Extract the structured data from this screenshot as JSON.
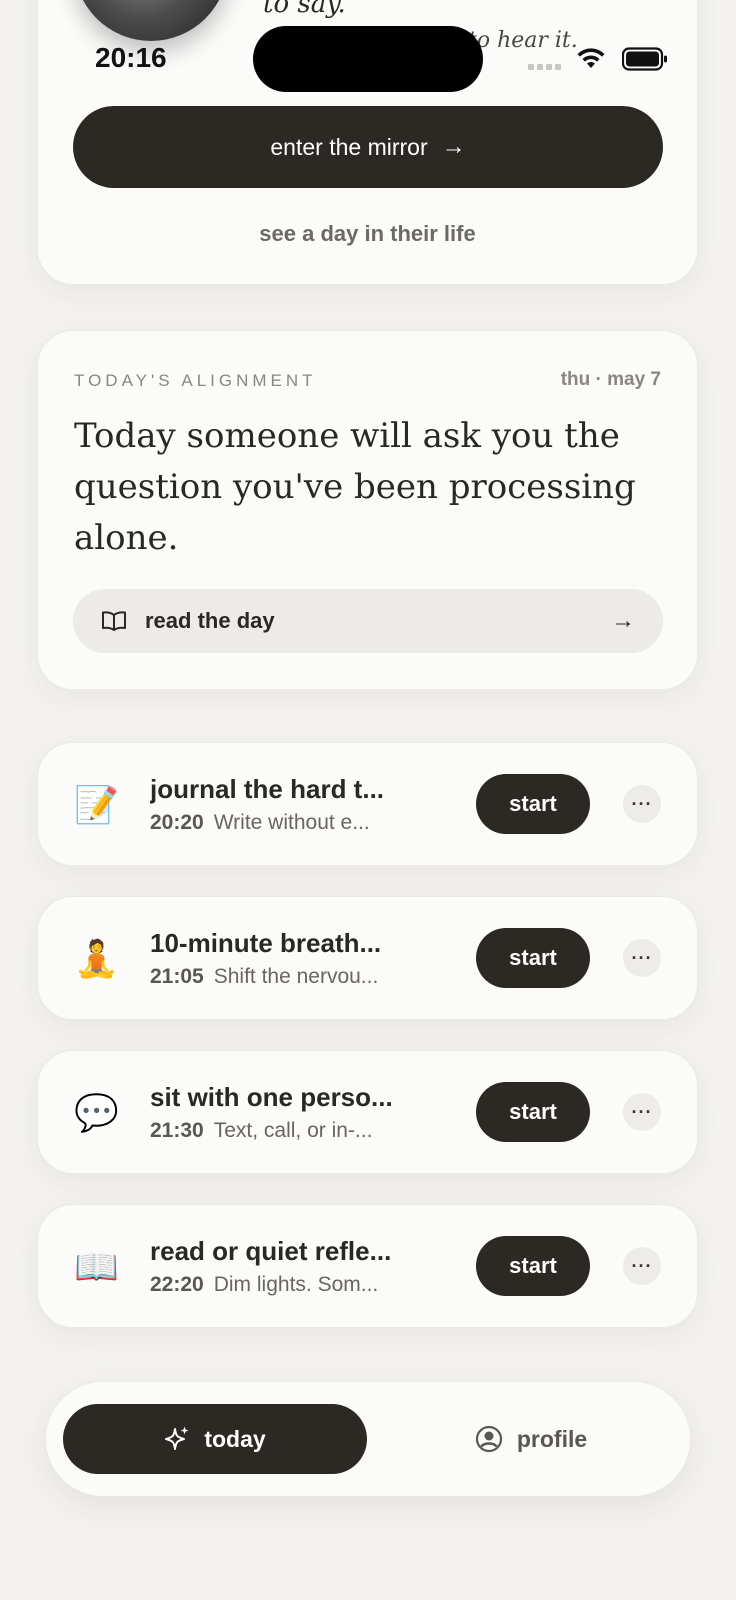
{
  "status_bar": {
    "time": "20:16"
  },
  "hero": {
    "quote_fragment_1": "to say.",
    "quote_fragment_2": "to hear it.",
    "primary_button": "enter the mirror",
    "secondary_link": "see a day in their life"
  },
  "alignment": {
    "eyebrow": "TODAY'S ALIGNMENT",
    "date": "thu · may 7",
    "message": "Today someone will ask you the question you've been processing alone.",
    "read_button": "read the day"
  },
  "tasks": [
    {
      "emoji": "📝",
      "icon": "memo-icon",
      "title": "journal the hard t...",
      "time": "20:20",
      "subtitle": "Write without e...",
      "action": "start",
      "more": "···"
    },
    {
      "emoji": "🧘",
      "icon": "meditation-icon",
      "title": "10-minute breath...",
      "time": "21:05",
      "subtitle": "Shift the nervou...",
      "action": "start",
      "more": "···"
    },
    {
      "emoji": "💬",
      "icon": "speech-bubble-icon",
      "title": "sit with one perso...",
      "time": "21:30",
      "subtitle": "Text, call, or in-...",
      "action": "start",
      "more": "···"
    },
    {
      "emoji": "📖",
      "icon": "open-book-icon",
      "title": "read or quiet refle...",
      "time": "22:20",
      "subtitle": "Dim lights. Som...",
      "action": "start",
      "more": "···"
    }
  ],
  "nav": {
    "today": "today",
    "profile": "profile"
  },
  "colors": {
    "accent_dark": "#2c2924",
    "background": "#f3f2f0",
    "card": "#fbfbfa"
  }
}
